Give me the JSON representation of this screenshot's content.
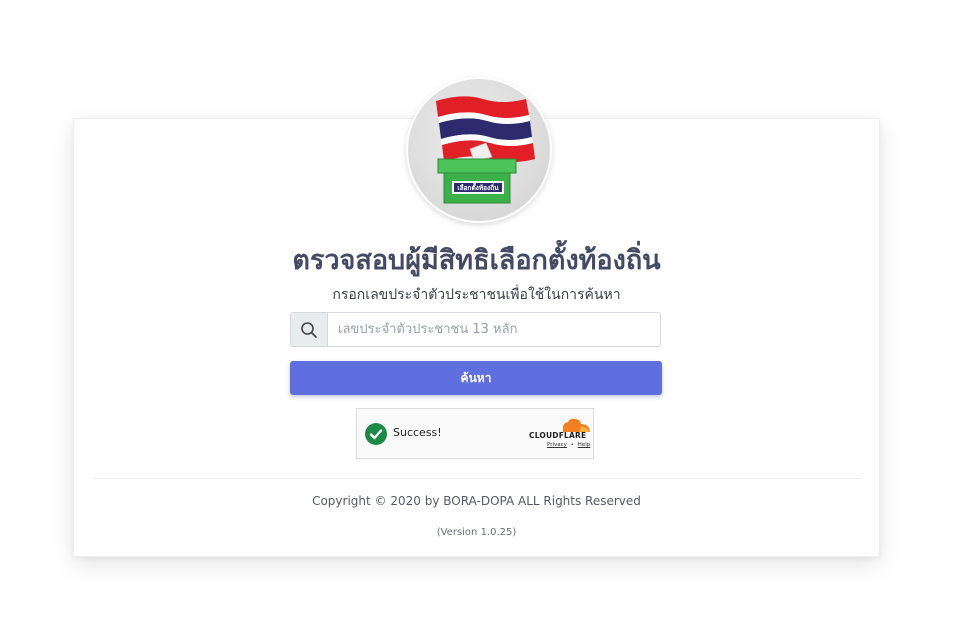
{
  "logo": {
    "ballot_label": "เลือกตั้งท้องถิ่น",
    "flag_colors": [
      "#e21e26",
      "#ffffff",
      "#2d2a6e"
    ],
    "box_color": "#3cb14a"
  },
  "header": {
    "title": "ตรวจสอบผู้มีสิทธิเลือกตั้งท้องถิ่น",
    "subtitle": "กรอกเลขประจำตัวประชาชนเพื่อใช้ในการค้นหา"
  },
  "search": {
    "icon": "search-icon",
    "placeholder": "เลขประจำตัวประชาชน 13 หลัก",
    "value": "",
    "button_label": "ค้นหา",
    "button_color": "#5f6fe0"
  },
  "captcha": {
    "status_text": "Success!",
    "provider": "CLOUDFLARE",
    "privacy_link": "Privacy",
    "separator": "•",
    "help_link": "Help",
    "check_color": "#1b8a47",
    "cloud_color": "#f38020"
  },
  "footer": {
    "copyright": "Copyright © 2020 by BORA-DOPA ALL Rights Reserved",
    "version": "(Version 1.0.25)"
  }
}
